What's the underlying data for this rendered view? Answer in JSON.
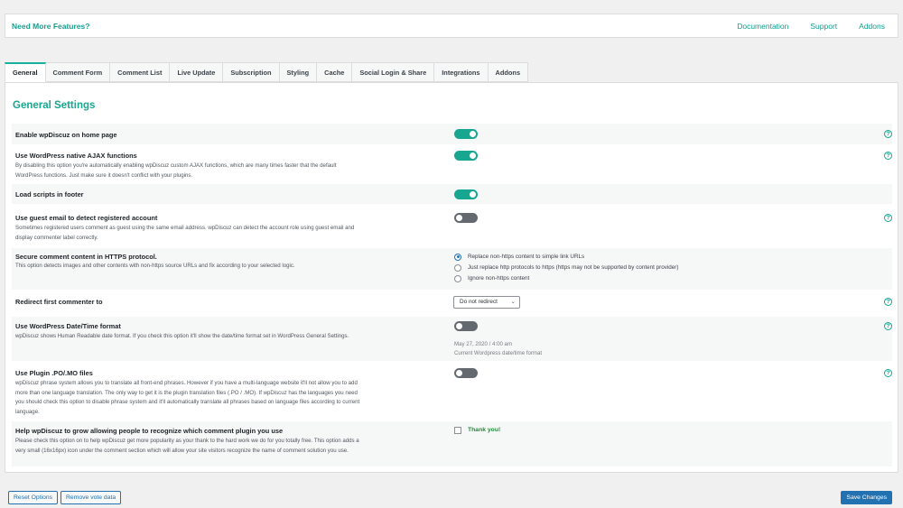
{
  "header": {
    "promo": "Need More Features?",
    "links": [
      "Documentation",
      "Support",
      "Addons"
    ]
  },
  "tabs": [
    "General",
    "Comment Form",
    "Comment List",
    "Live Update",
    "Subscription",
    "Styling",
    "Cache",
    "Social Login & Share",
    "Integrations",
    "Addons"
  ],
  "active_tab": "General",
  "panel_title": "General Settings",
  "help_icon": "?",
  "settings": {
    "home_page": {
      "label": "Enable wpDiscuz on home page",
      "enabled": true
    },
    "ajax": {
      "label": "Use WordPress native AJAX functions",
      "description": "By disabling this option you're automatically enabling wpDiscuz custom AJAX functions, which are many times faster that the default WordPress functions. Just make sure it doesn't conflict with your plugins.",
      "enabled": true
    },
    "footer_scripts": {
      "label": "Load scripts in footer",
      "enabled": true
    },
    "guest_email": {
      "label": "Use guest email to detect registered account",
      "description": "Sometimes registered users comment as guest using the same email address. wpDiscuz can detect the account role using guest email and display commenter label correctly.",
      "enabled": false
    },
    "https": {
      "label": "Secure comment content in HTTPS protocol.",
      "description": "This option detects images and other contents with non-https source URLs and fix according to your selected logic.",
      "options": [
        "Replace non-https content to simple link URLs",
        "Just replace http protocols to https (https may not be supported by content provider)",
        "Ignore non-https content"
      ],
      "selected": "Replace non-https content to simple link URLs"
    },
    "redirect": {
      "label": "Redirect first commenter to",
      "value": "Do not redirect"
    },
    "date_format": {
      "label": "Use WordPress Date/Time format",
      "description": "wpDiscuz shows Human Readable date format. If you check this option it'll show the date/time format set in WordPress General Settings.",
      "enabled": false,
      "sample_date": "May 27, 2020 / 4:00 am",
      "sample_note": "Current Wordpress date/time format"
    },
    "po_mo": {
      "label": "Use Plugin .PO/.MO files",
      "description": "wpDiscuz phrase system allows you to translate all front-end phrases. However if you have a multi-language website it'll not allow you to add more than one language translation. The only way to get it is the plugin translation files (.PO / .MO). If wpDiscuz has the languages you need you should check this option to disable phrase system and it'll automatically translate all phrases based on language files according to current language.",
      "enabled": false
    },
    "promote": {
      "label": "Help wpDiscuz to grow allowing people to recognize which comment plugin you use",
      "description": "Please check this option on to help wpDiscuz get more popularity as your thank to the hard work we do for you totally free. This option adds a very small (16x16px) icon under the comment section which will allow your site visitors recognize the name of comment solution you use.",
      "checked": false,
      "check_label": "Thank you!"
    }
  },
  "footer": {
    "reset": "Reset Options",
    "remove_votes": "Remove vote data",
    "save": "Save Changes"
  },
  "colors": {
    "accent": "#17a68f",
    "primary": "#2271b1",
    "thank_you": "#1e8c3a"
  },
  "icons": {
    "help": "question-circle-icon",
    "dropdown": "chevron-down-icon"
  }
}
